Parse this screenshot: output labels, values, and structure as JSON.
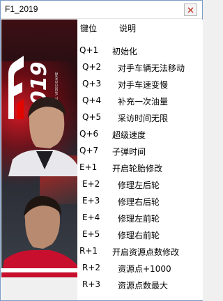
{
  "window": {
    "title": "F1_2019",
    "close_symbol": "x"
  },
  "header": {
    "key_label": "键位",
    "desc_label": "说明"
  },
  "rows": [
    {
      "key": "Q+1",
      "desc": "初始化"
    },
    {
      "key": "Q+2",
      "desc": "对手车辆无法移动"
    },
    {
      "key": "Q+3",
      "desc": "对手车速变慢"
    },
    {
      "key": "Q+4",
      "desc": "补充一次油量"
    },
    {
      "key": "Q+5",
      "desc": "采访时间无限"
    },
    {
      "key": "Q+6",
      "desc": "超级速度"
    },
    {
      "key": "Q+7",
      "desc": "子弹时间"
    },
    {
      "key": "E+1",
      "desc": "开启轮胎修改"
    },
    {
      "key": "E+2",
      "desc": "修理左后轮"
    },
    {
      "key": "E+3",
      "desc": "修理右后轮"
    },
    {
      "key": "E+4",
      "desc": "修理左前轮"
    },
    {
      "key": "E+5",
      "desc": "修理右前轮"
    },
    {
      "key": "R+1",
      "desc": "开启资源点数修改"
    },
    {
      "key": "R+2",
      "desc": "资源点+1000"
    },
    {
      "key": "R+3",
      "desc": "资源点数最大"
    }
  ],
  "cover": {
    "logo_text": "2019",
    "tagline": "THE OFFICIAL VIDEOGAME",
    "brand_color": "#d21a25"
  }
}
